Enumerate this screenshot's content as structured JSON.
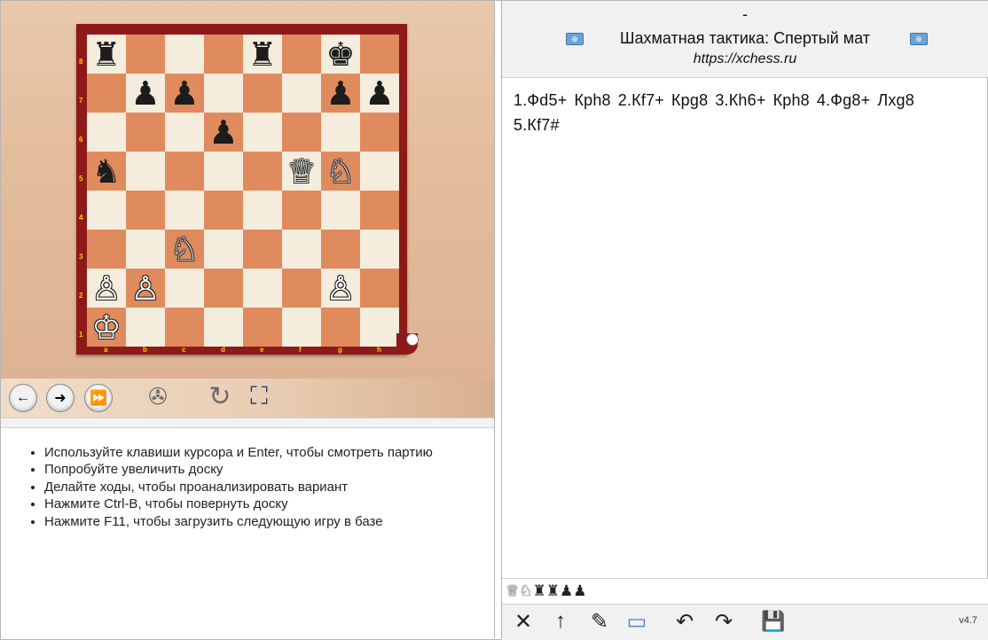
{
  "board": {
    "files": [
      "a",
      "b",
      "c",
      "d",
      "e",
      "f",
      "g",
      "h"
    ],
    "ranks": [
      "8",
      "7",
      "6",
      "5",
      "4",
      "3",
      "2",
      "1"
    ],
    "position": [
      [
        "♜",
        "",
        "",
        "",
        "♜",
        "",
        "♚",
        ""
      ],
      [
        "",
        "♟",
        "♟",
        "",
        "",
        "",
        "♟",
        "♟"
      ],
      [
        "",
        "",
        "",
        "♟",
        "",
        "",
        "",
        ""
      ],
      [
        "♞",
        "",
        "",
        "",
        "",
        "♕",
        "♘",
        ""
      ],
      [
        "",
        "",
        "",
        "",
        "",
        "",
        "",
        ""
      ],
      [
        "",
        "",
        "♘",
        "",
        "",
        "",
        "",
        ""
      ],
      [
        "♙",
        "♙",
        "",
        "",
        "",
        "",
        "♙",
        ""
      ],
      [
        "♔",
        "",
        "",
        "",
        "",
        "",
        "",
        ""
      ]
    ]
  },
  "toolbar_left": {
    "back_icon": "←",
    "forward_icon": "➜",
    "end_icon": "⏩",
    "engine_icon": "✇",
    "flip_icon": "↻",
    "fullscreen_icon": "⛶"
  },
  "tips": [
    "Используйте клавиши курсора и Enter, чтобы смотреть партию",
    "Попробуйте увеличить доску",
    "Делайте ходы, чтобы проанализировать вариант",
    "Нажмите Ctrl-B, чтобы повернуть доску",
    "Нажмите F11, чтобы загрузить следующую игру в базе"
  ],
  "header": {
    "dash": "-",
    "title": "Шахматная тактика: Спертый мат",
    "url": "https://xchess.ru"
  },
  "moves": [
    "1.Фd5+",
    "Крh8",
    "2.Кf7+",
    "Крg8",
    "3.Кh6+",
    "Крh8",
    "4.Фg8+",
    "Лxg8",
    "5.Кf7#"
  ],
  "captured": {
    "white": [
      "♕",
      "♘"
    ],
    "black": [
      "♜",
      "♜",
      "♟",
      "♟"
    ]
  },
  "bottom_bar": {
    "version": "v4.7",
    "icons": [
      "✕",
      "↑",
      "✎",
      "▭",
      "↶",
      "↷",
      "💾"
    ]
  }
}
